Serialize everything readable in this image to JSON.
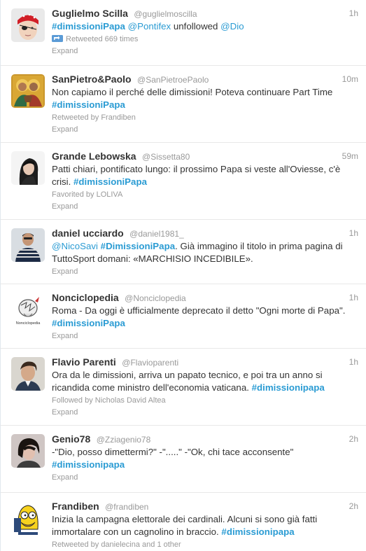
{
  "tweets": [
    {
      "fullname": "Guglielmo Scilla",
      "username": "@guglielmoscilla",
      "time": "1h",
      "parts": [
        {
          "t": "#dimissioniPapa",
          "k": "hashtag"
        },
        {
          "t": " ",
          "k": "text"
        },
        {
          "t": "@Pontifex",
          "k": "mention"
        },
        {
          "t": " unfollowed ",
          "k": "text"
        },
        {
          "t": "@Dio",
          "k": "mention"
        }
      ],
      "meta": "Retweeted 669 times",
      "meta_icon": "retweet-icon",
      "expand": "Expand",
      "avatar": "pirate-bandana-avatar"
    },
    {
      "fullname": "SanPietro&Paolo",
      "username": "@SanPietroePaolo",
      "time": "10m",
      "parts": [
        {
          "t": "Non capiamo il perché delle dimissioni! Poteva continuare Part Time ",
          "k": "text"
        },
        {
          "t": "#dimissioniPapa",
          "k": "hashtag"
        }
      ],
      "meta": "Retweeted by Frandiben",
      "expand": "Expand",
      "avatar": "icon-saints-avatar"
    },
    {
      "fullname": "Grande Lebowska",
      "username": "@Sissetta80",
      "time": "59m",
      "parts": [
        {
          "t": "Patti chiari, pontificato lungo: il prossimo Papa si veste all'Oviesse, c'è crisi. ",
          "k": "text"
        },
        {
          "t": "#dimissioniPapa",
          "k": "hashtag"
        }
      ],
      "meta": "Favorited by LOLIVA",
      "expand": "Expand",
      "avatar": "woman-portrait-avatar"
    },
    {
      "fullname": "daniel ucciardo",
      "username": "@daniel1981_",
      "time": "1h",
      "parts": [
        {
          "t": "@NicoSavi",
          "k": "mention"
        },
        {
          "t": " ",
          "k": "text"
        },
        {
          "t": "#DimissioniPapa",
          "k": "hashtag"
        },
        {
          "t": ". Già immagino il titolo in prima pagina di TuttoSport domani: «MARCHISIO INCEDIBILE».",
          "k": "text"
        }
      ],
      "meta": "",
      "expand": "Expand",
      "avatar": "striped-shirt-avatar"
    },
    {
      "fullname": "Nonciclopedia",
      "username": "@Nonciclopedia",
      "time": "1h",
      "parts": [
        {
          "t": "Roma - Da oggi è ufficialmente deprecato il detto \"Ogni morte di Papa\". ",
          "k": "text"
        },
        {
          "t": "#dimissioniPapa",
          "k": "hashtag"
        }
      ],
      "meta": "",
      "expand": "Expand",
      "avatar": "nonciclopedia-logo-avatar",
      "avatar_text": "Nonciclopedia"
    },
    {
      "fullname": "Flavio Parenti",
      "username": "@Flavioparenti",
      "time": "1h",
      "parts": [
        {
          "t": "Ora da le dimissioni, arriva un papato tecnico, e poi tra un anno si ricandida come ministro dell'economia vaticana. ",
          "k": "text"
        },
        {
          "t": "#dimissionipapa",
          "k": "hashtag"
        }
      ],
      "meta": "Followed by Nicholas David Altea",
      "expand": "Expand",
      "avatar": "man-portrait-avatar"
    },
    {
      "fullname": "Genio78",
      "username": "@Zziagenio78",
      "time": "2h",
      "parts": [
        {
          "t": "-\"Dio, posso dimettermi?\" -\".....\" -\"Ok, chi tace acconsente\" ",
          "k": "text"
        },
        {
          "t": "#dimissionipapa",
          "k": "hashtag"
        }
      ],
      "meta": "",
      "expand": "Expand",
      "avatar": "dark-hair-avatar"
    },
    {
      "fullname": "Frandiben",
      "username": "@frandiben",
      "time": "2h",
      "parts": [
        {
          "t": "Inizia la campagna elettorale dei cardinali. Alcuni si sono già fatti immortalare con un cagnolino in braccio. ",
          "k": "text"
        },
        {
          "t": "#dimissionipapa",
          "k": "hashtag"
        }
      ],
      "meta": "Retweeted by danielecina and 1 other",
      "expand": "",
      "avatar": "cartoon-yellow-avatar"
    }
  ],
  "colors": {
    "link": "#2a9bd3",
    "name": "#333333",
    "muted": "#999999",
    "divider": "#e8e8e8"
  }
}
